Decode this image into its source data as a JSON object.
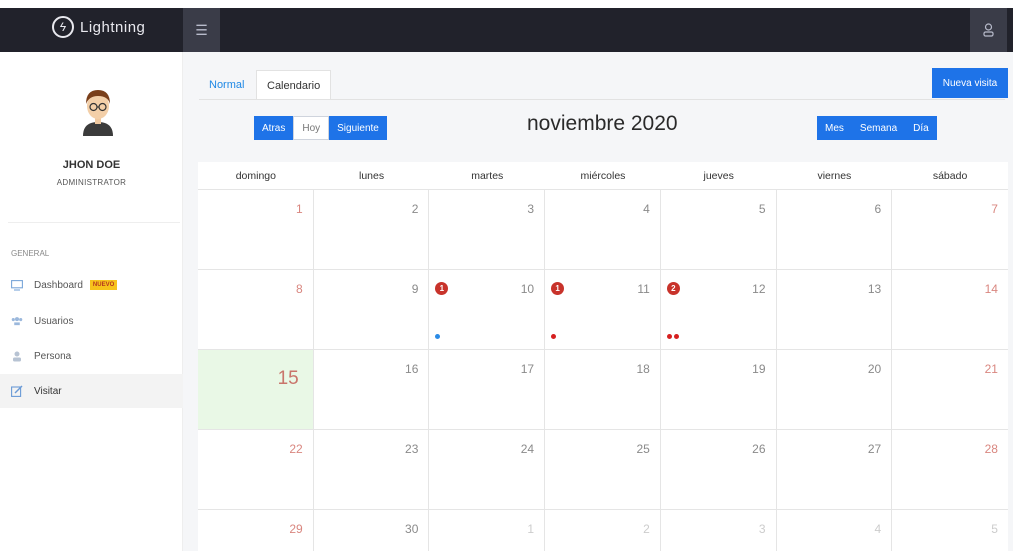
{
  "app": {
    "brand": "Lightning"
  },
  "topbar": {
    "menu_icon": "hamburger-icon",
    "user_icon": "user-icon"
  },
  "sidebar": {
    "user_name": "JHON DOE",
    "user_role": "ADMINISTRATOR",
    "section": "GENERAL",
    "items": [
      {
        "label": "Dashboard",
        "icon": "monitor-icon",
        "badge": "NUEVO"
      },
      {
        "label": "Usuarios",
        "icon": "users-icon"
      },
      {
        "label": "Persona",
        "icon": "person-icon"
      },
      {
        "label": "Visitar",
        "icon": "edit-icon",
        "active": true
      }
    ]
  },
  "tabs": [
    "Normal",
    "Calendario"
  ],
  "new_visit_label": "Nueva visita",
  "nav_buttons": [
    "Atras",
    "Hoy",
    "Siguiente"
  ],
  "view_buttons": [
    "Mes",
    "Semana",
    "Día"
  ],
  "calendar": {
    "title": "noviembre 2020",
    "weekdays": [
      "domingo",
      "lunes",
      "martes",
      "miércoles",
      "jueves",
      "viernes",
      "sábado"
    ],
    "weeks": [
      [
        "1",
        "2",
        "3",
        "4",
        "5",
        "6",
        "7"
      ],
      [
        "8",
        "9",
        "10",
        "11",
        "12",
        "13",
        "14"
      ],
      [
        "15",
        "16",
        "17",
        "18",
        "19",
        "20",
        "21"
      ],
      [
        "22",
        "23",
        "24",
        "25",
        "26",
        "27",
        "28"
      ],
      [
        "29",
        "30",
        "1",
        "2",
        "3",
        "4",
        "5"
      ]
    ],
    "today": "15",
    "events": [
      {
        "day": "10",
        "count": "1",
        "dot_colors": [
          "#2b8be6"
        ]
      },
      {
        "day": "11",
        "count": "1",
        "dot_colors": [
          "#d62020"
        ]
      },
      {
        "day": "12",
        "count": "2",
        "dot_colors": [
          "#d62020",
          "#d62020"
        ]
      }
    ]
  },
  "colors": {
    "accent": "#1e73e8",
    "topbar": "#21222b",
    "today_bg": "#e9f8e6",
    "badge": "#c8332b"
  }
}
